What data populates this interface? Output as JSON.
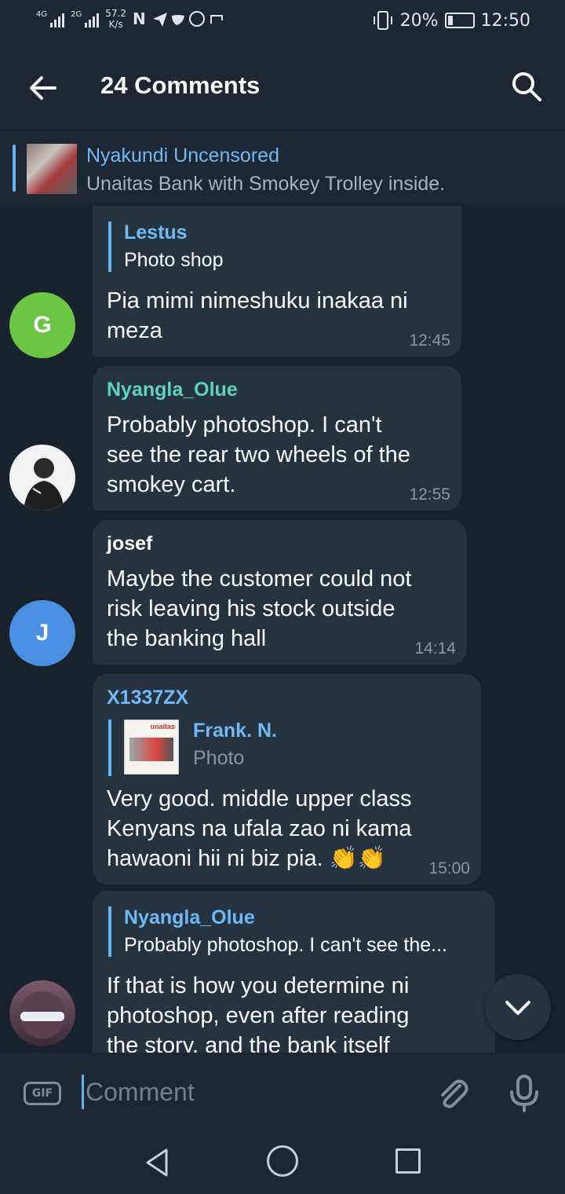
{
  "status_bar": {
    "network1": "4G",
    "network2": "2G",
    "speed_value": "57.2",
    "speed_unit": "K/s",
    "battery_percent": "20%",
    "battery_level": 0.2,
    "time": "12:50"
  },
  "header": {
    "title": "24 Comments"
  },
  "pinned": {
    "name": "Nyakundi Uncensored",
    "text": "Unaitas Bank with Smokey Trolley inside."
  },
  "comments": [
    {
      "avatar_letter": "G",
      "avatar_color": "#6dc544",
      "reply_to_name": "Lestus",
      "reply_to_text": "Photo shop",
      "text_lines": [
        "Pia mimi nimeshuku inakaa ni",
        "meza"
      ],
      "time": "12:45"
    },
    {
      "sender": "Nyangla_Olue",
      "sender_color": "#5fd0c4",
      "text_lines": [
        "Probably photoshop. I can't",
        "see the rear two wheels of the",
        "smokey cart."
      ],
      "time": "12:55"
    },
    {
      "sender": "josef",
      "sender_color": "#71b9f4",
      "avatar_letter": "J",
      "avatar_color": "#4a90e2",
      "text_lines": [
        "Maybe the customer could not",
        "risk leaving his stock outside",
        "the banking hall"
      ],
      "time": "14:14"
    },
    {
      "sender": "X1337ZX",
      "sender_color": "#71b9f4",
      "reply_to_name": "Frank. N.",
      "reply_to_text": "Photo",
      "reply_thumb_logo": "unaitas",
      "text_lines": [
        "Very good. middle upper class",
        "Kenyans na ufala zao ni kama",
        "hawaoni hii ni biz pia. 👏👏"
      ],
      "time": "15:00"
    },
    {
      "reply_to_name": "Nyangla_Olue",
      "reply_to_text": "Probably photoshop. I can't see the...",
      "text_lines": [
        "If that is how you determine ni",
        "photoshop, even after reading",
        "the story, and the bank itself"
      ]
    }
  ],
  "input": {
    "gif_label": "GIF",
    "placeholder": "Comment"
  },
  "colors": {
    "background": "#18222d",
    "bar": "#1d2733",
    "bubble": "#253240",
    "accent": "#64b5ef"
  }
}
